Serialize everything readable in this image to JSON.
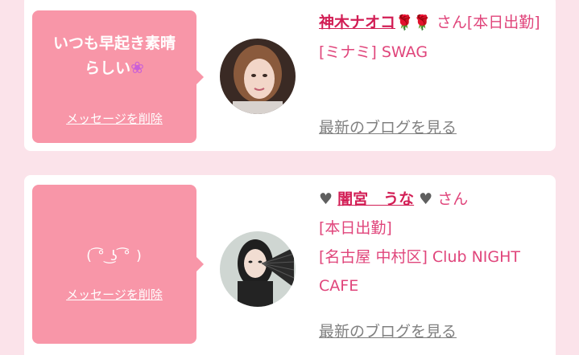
{
  "cards": [
    {
      "message_line1": "いつも早起き素晴",
      "message_line2": "らしい",
      "delete_label": "メッセージを削除",
      "name": "神木ナオコ",
      "name_deco": "🌹🌹",
      "san": "さん[本日出勤]",
      "shop": "[ミナミ] SWAG",
      "blog_label": "最新のブログを見る"
    },
    {
      "message": "(  ͡° ͜ʖ ͡°  )",
      "delete_label": "メッセージを削除",
      "name": "闇宮　うな",
      "san": "さん",
      "status": "[本日出勤]",
      "shop": "[名古屋 中村区] Club NIGHT CAFE",
      "blog_label": "最新のブログを見る"
    }
  ],
  "colors": {
    "page_bg": "#fbe3ea",
    "bubble_bg": "#f896a8",
    "name_color": "#d21e55",
    "text_pink": "#e0457b",
    "link_gray": "#808080"
  },
  "icons": [
    "clover-icon",
    "rose-icon",
    "heart-icon"
  ]
}
